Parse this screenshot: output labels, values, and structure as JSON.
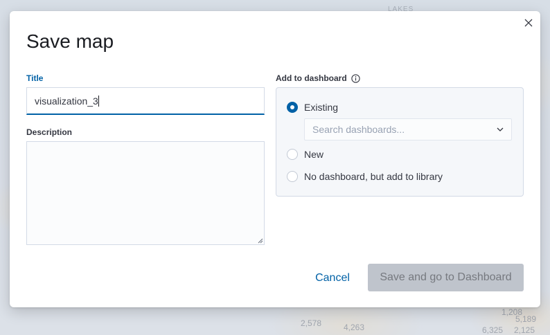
{
  "background": {
    "labels": [
      "LAKES",
      "2,578",
      "4,263",
      "1,208",
      "5,189",
      "6,325",
      "2,125"
    ]
  },
  "modal": {
    "title": "Save map",
    "close_icon": "close-icon",
    "title_field": {
      "label": "Title",
      "value": "visualization_3"
    },
    "description_field": {
      "label": "Description",
      "value": ""
    },
    "dashboard": {
      "label": "Add to dashboard",
      "info_icon": "info-icon",
      "options": [
        {
          "label": "Existing",
          "checked": true
        },
        {
          "label": "New",
          "checked": false
        },
        {
          "label": "No dashboard, but add to library",
          "checked": false
        }
      ],
      "search_placeholder": "Search dashboards..."
    },
    "footer": {
      "cancel_label": "Cancel",
      "save_label": "Save and go to Dashboard"
    }
  },
  "colors": {
    "primary": "#0061a6",
    "disabled_button": "#bfc4cc",
    "panel_bg": "#f5f7fa"
  }
}
